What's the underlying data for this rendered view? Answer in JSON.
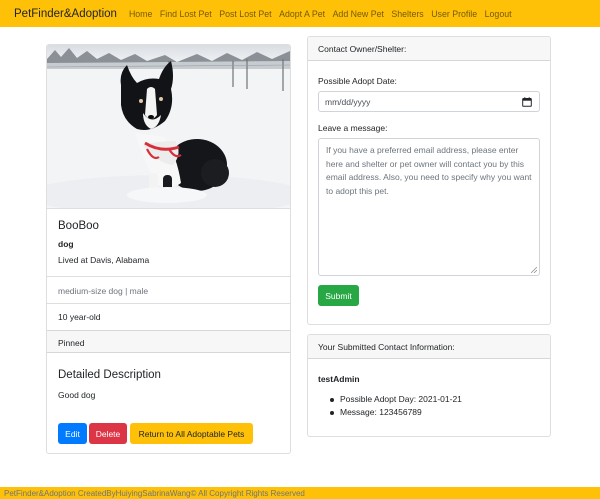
{
  "nav": {
    "brand": "PetFinder&Adoption",
    "links": [
      "Home",
      "Find Lost Pet",
      "Post Lost Pet",
      "Adopt A Pet",
      "Add New Pet",
      "Shelters",
      "User Profile",
      "Logout"
    ]
  },
  "pet": {
    "name": "BooBoo",
    "species": "dog",
    "location": "Lived at Davis, Alabama",
    "size_gender": "medium-size dog | male",
    "age": "10 year-old",
    "status": "Pinned",
    "description_title": "Detailed Description",
    "description": "Good dog",
    "buttons": {
      "edit": "Edit",
      "delete": "Delete",
      "return": "Return to All Adoptable Pets"
    }
  },
  "contact": {
    "header": "Contact Owner/Shelter:",
    "date_label": "Possible Adopt Date:",
    "date_placeholder": "mm/dd/yyyy",
    "message_label": "Leave a message:",
    "message_placeholder": "If you have a preferred email address, please enter here and shelter or pet owner will contact you by this email address. Also, you need to specify why you want to adopt this pet.",
    "submit": "Submit"
  },
  "submitted": {
    "header": "Your Submitted Contact Information:",
    "user": "testAdmin",
    "items": [
      "Possible Adopt Day: 2021-01-21",
      "Message: 123456789"
    ]
  },
  "footer": "PetFinder&Adoption CreatedByHuiyingSabrinaWang© All Copyright Rights Reserved",
  "colors": {
    "navbar": "#ffc107",
    "edit": "#007bff",
    "delete": "#dc3545",
    "submit": "#28a745"
  }
}
